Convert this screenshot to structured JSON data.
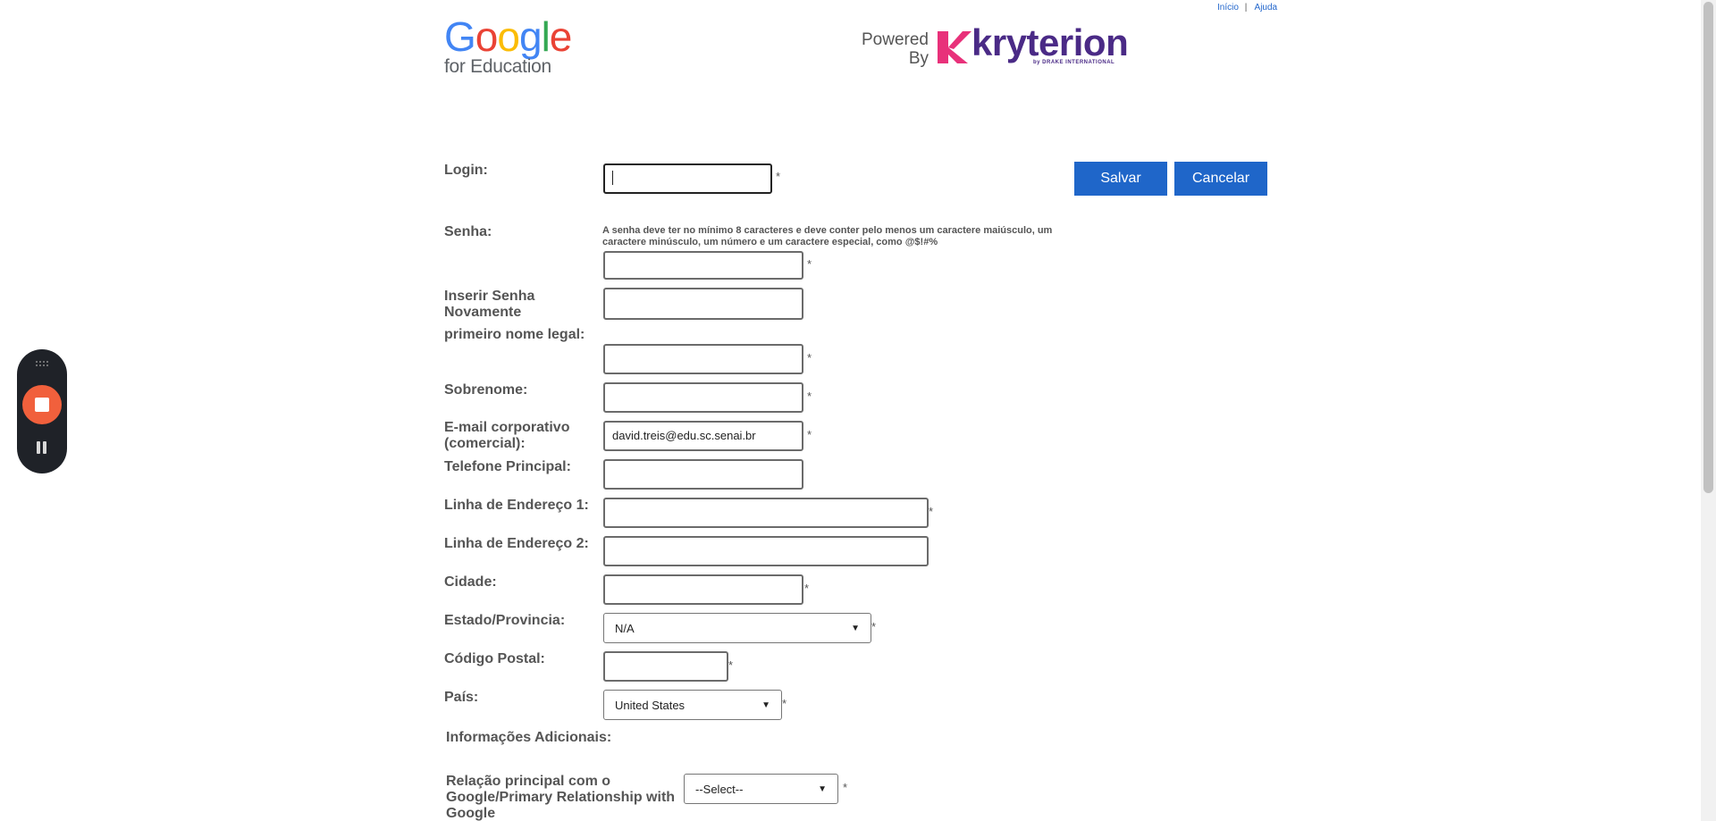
{
  "top_links": {
    "home": "Início",
    "separator": "|",
    "help": "Ajuda"
  },
  "google_logo": {
    "letters": [
      "G",
      "o",
      "o",
      "g",
      "l",
      "e"
    ],
    "letter_colors": [
      "#4285F4",
      "#EA4335",
      "#FBBC05",
      "#4285F4",
      "#34A853",
      "#EA4335"
    ],
    "subtitle": "for Education"
  },
  "kryterion_logo": {
    "powered_line1": "Powered",
    "powered_line2": "By",
    "brand": "kryterion",
    "tagline": "by DRAKE INTERNATIONAL",
    "brand_color": "#4A2A86",
    "mark_color": "#E8317A"
  },
  "buttons": {
    "save": "Salvar",
    "cancel": "Cancelar",
    "color": "#1F66C9"
  },
  "required_marker": "*",
  "form": {
    "login_label": "Login:",
    "login_value": "",
    "password_label": "Senha:",
    "password_hint": "A senha deve ter no mínimo 8 caracteres e deve conter pelo menos um caractere maiúsculo, um caractere minúsculo, um número e um caractere especial, como @$!#%",
    "password_confirm_label": "Inserir Senha Novamente",
    "first_name_label": "primeiro nome legal:",
    "last_name_label": "Sobrenome:",
    "email_label": "E-mail corporativo (comercial):",
    "email_value": "david.treis@edu.sc.senai.br",
    "phone_label": "Telefone Principal:",
    "address1_label": "Linha de Endereço 1:",
    "address2_label": "Linha de Endereço 2:",
    "city_label": "Cidade:",
    "state_label": "Estado/Provincia:",
    "state_value": "N/A",
    "postal_label": "Código Postal:",
    "country_label": "País:",
    "country_value": "United States",
    "additional_label": "Informações Adicionais:",
    "relationship_label": "Relação principal com o Google/Primary Relationship with Google",
    "relationship_value": "--Select--"
  },
  "recorder": {
    "stop_color": "#F1603C",
    "body_color": "#1F2228"
  }
}
